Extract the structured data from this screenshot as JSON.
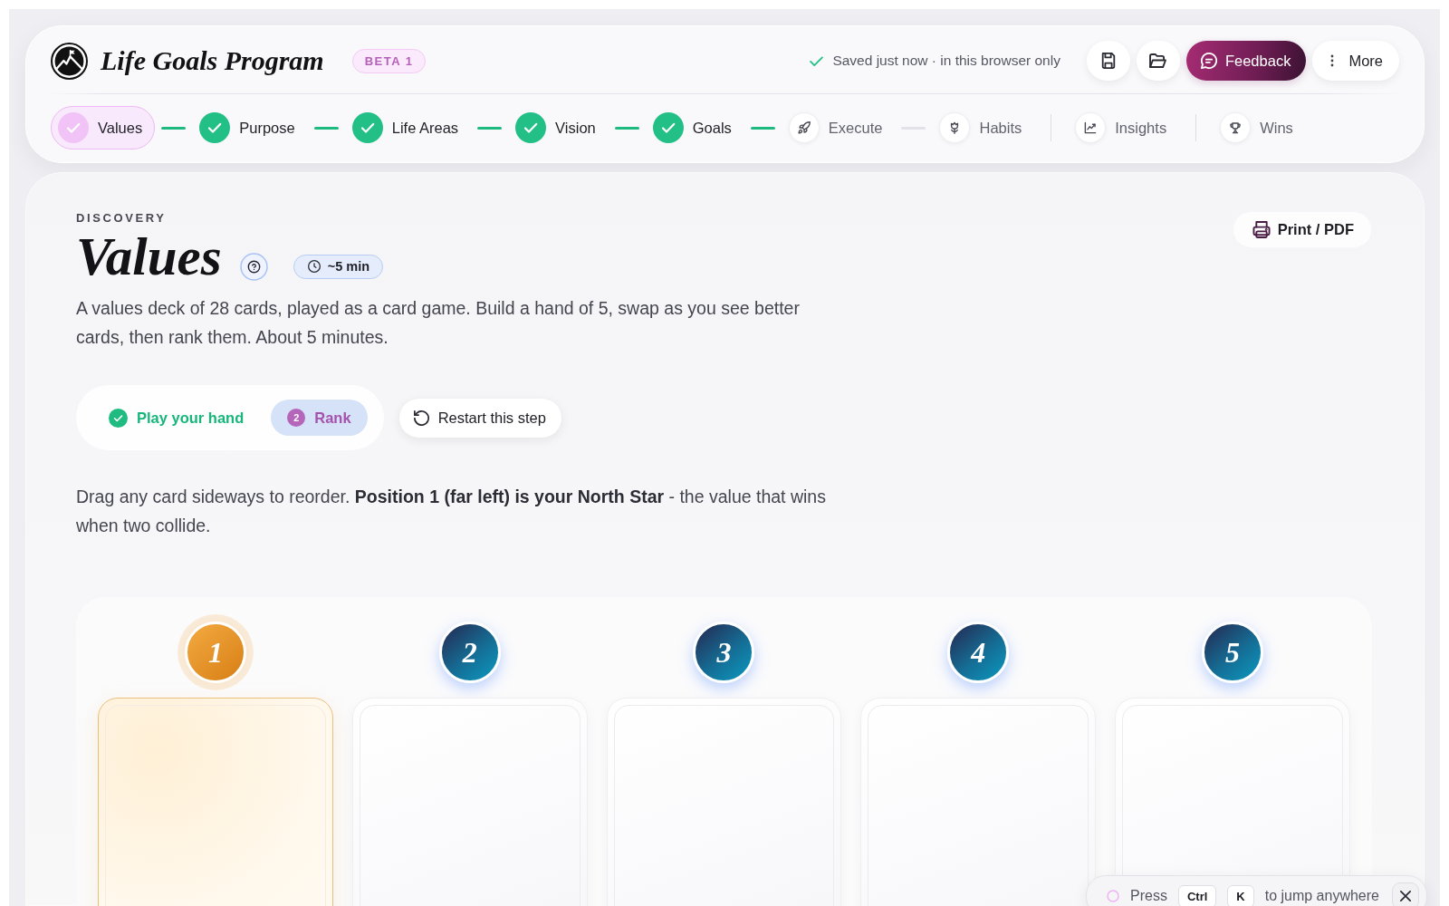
{
  "app": {
    "title": "Life Goals Program",
    "badge": "BETA 1"
  },
  "save_status": "Saved just now · in this browser only",
  "header_actions": {
    "feedback": "Feedback",
    "more": "More"
  },
  "steps": [
    {
      "label": "Values",
      "kind": "step",
      "done": true,
      "selected": true
    },
    {
      "label": "Purpose",
      "kind": "step",
      "done": true,
      "selected": false
    },
    {
      "label": "Life Areas",
      "kind": "step",
      "done": true,
      "selected": false
    },
    {
      "label": "Vision",
      "kind": "step",
      "done": true,
      "selected": false
    },
    {
      "label": "Goals",
      "kind": "step",
      "done": true,
      "selected": false
    },
    {
      "label": "Execute",
      "kind": "step",
      "done": false,
      "selected": false
    },
    {
      "label": "Habits",
      "kind": "step",
      "done": false,
      "selected": false
    },
    {
      "label": "Insights",
      "kind": "tool",
      "done": false,
      "selected": false
    },
    {
      "label": "Wins",
      "kind": "tool",
      "done": false,
      "selected": false
    }
  ],
  "page": {
    "eyebrow": "DISCOVERY",
    "title": "Values",
    "duration": "~5 min",
    "description": "A values deck of 28 cards, played as a card game. Build a hand of 5, swap as you see better cards, then rank them. About 5 minutes.",
    "print_button": "Print / PDF"
  },
  "phases": [
    {
      "label": "Play your hand",
      "done": true,
      "selected": false
    },
    {
      "number": "2",
      "label": "Rank",
      "done": false,
      "selected": true
    }
  ],
  "restart_button": "Restart this step",
  "instruction": "Drag any card sideways to reorder. **Position 1 (far left) is your North Star** - the value that wins when two collide.",
  "hand": [
    {
      "rank": "1",
      "kind": "north_star"
    },
    {
      "rank": "2",
      "kind": "standard"
    },
    {
      "rank": "3",
      "kind": "standard"
    },
    {
      "rank": "4",
      "kind": "standard"
    },
    {
      "rank": "5",
      "kind": "standard"
    }
  ],
  "shortcut_hint": {
    "before": "Press",
    "keys": [
      "Ctrl",
      "K"
    ],
    "after": "to jump anywhere"
  }
}
